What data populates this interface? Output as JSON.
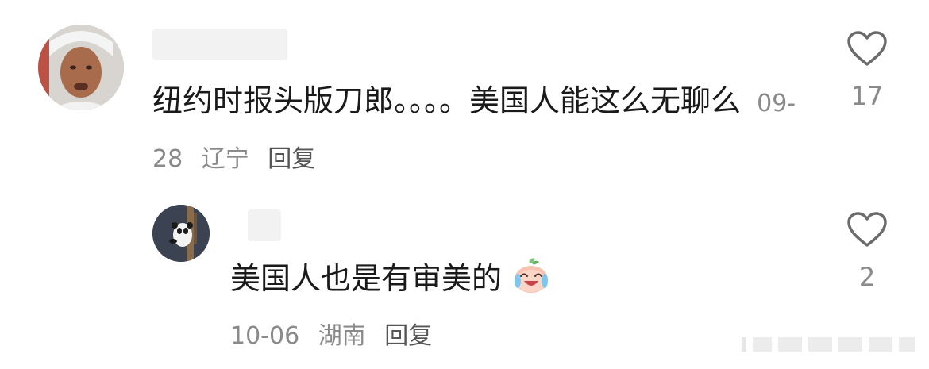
{
  "comments": [
    {
      "text": "纽约时报头版刀郎。。。。美国人能这么无聊么",
      "date": "09-28",
      "location": "辽宁",
      "reply_label": "回复",
      "like_count": "17"
    },
    {
      "text": "美国人也是有审美的",
      "emoji": "crying-laughing-peach-emoji",
      "date": "10-06",
      "location": "湖南",
      "reply_label": "回复",
      "like_count": "2"
    }
  ],
  "colors": {
    "text": "#1a1a1a",
    "meta": "#8a8a8a",
    "heart_stroke": "#6b6b6b"
  }
}
